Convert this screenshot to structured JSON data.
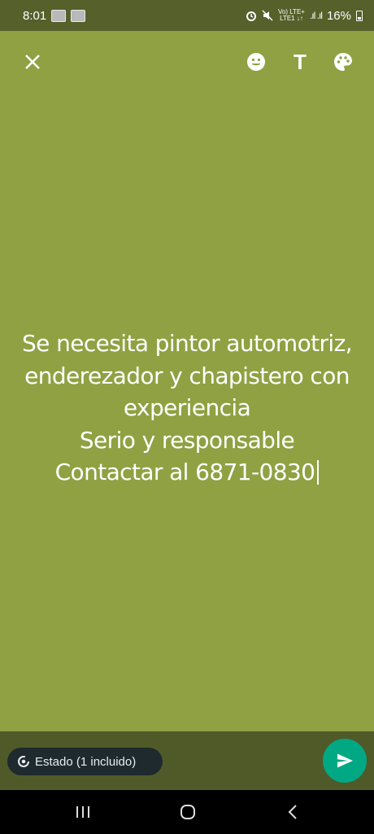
{
  "status_bar": {
    "time": "8:01",
    "network_label": "Vo) LTE+\nLTE1 ↓↑",
    "battery": "16%"
  },
  "toolbar": {
    "icons": [
      "close-icon",
      "emoji-icon",
      "text-style-icon",
      "palette-icon"
    ],
    "text_button_label": "T"
  },
  "editor": {
    "text": "Se necesita pintor automotriz,\nenderezador y chapistero con\nexperiencia\nSerio y responsable\nContactar al 6871-0830",
    "background_color": "#8fa142"
  },
  "footer": {
    "audience_label": "Estado (1 incluido)",
    "send_color": "#00a884"
  }
}
